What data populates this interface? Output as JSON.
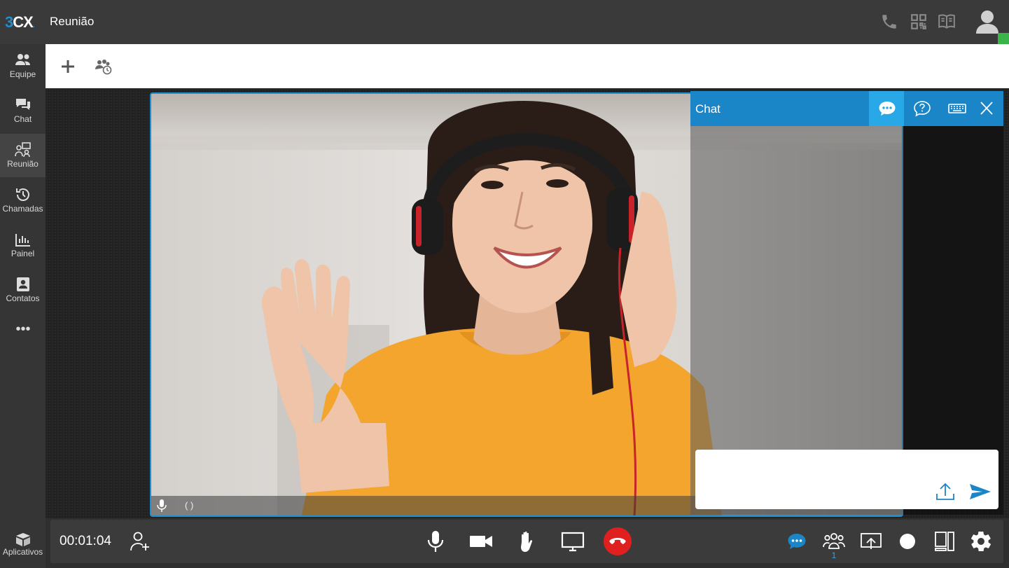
{
  "app": {
    "logo_digit": "3",
    "logo_letters": "CX",
    "title": "Reunião"
  },
  "header_icons": [
    "phone-icon",
    "qr-code-icon",
    "book-icon",
    "user-avatar-icon"
  ],
  "sidebar": {
    "items": [
      {
        "label": "Equipe",
        "icon": "team-icon"
      },
      {
        "label": "Chat",
        "icon": "chat-icon"
      },
      {
        "label": "Reunião",
        "icon": "meeting-icon",
        "active": true
      },
      {
        "label": "Chamadas",
        "icon": "history-icon"
      },
      {
        "label": "Painel",
        "icon": "dashboard-icon"
      },
      {
        "label": "Contatos",
        "icon": "contacts-icon"
      }
    ],
    "more": "•••",
    "apps_label": "Aplicativos"
  },
  "toolbar": {
    "buttons": [
      "add-icon",
      "scheduled-meeting-icon"
    ]
  },
  "video": {
    "name_placeholder": "(      )"
  },
  "chat": {
    "title": "Chat",
    "header_buttons": [
      "chat-bubble-icon",
      "help-icon",
      "keyboard-icon",
      "close-icon"
    ],
    "input_value": ""
  },
  "controls": {
    "timer": "00:01:04",
    "participants_count": "1",
    "center": [
      "microphone-icon",
      "camera-icon",
      "raise-hand-icon",
      "screen-share-icon",
      "hangup-icon"
    ],
    "right": [
      "chat-icon",
      "participants-icon",
      "present-icon",
      "record-icon",
      "layout-icon",
      "settings-icon"
    ]
  },
  "colors": {
    "accent": "#1a86c7",
    "accent_light": "#29a8e8",
    "hangup": "#e0201f",
    "presence": "#3ab54a"
  }
}
